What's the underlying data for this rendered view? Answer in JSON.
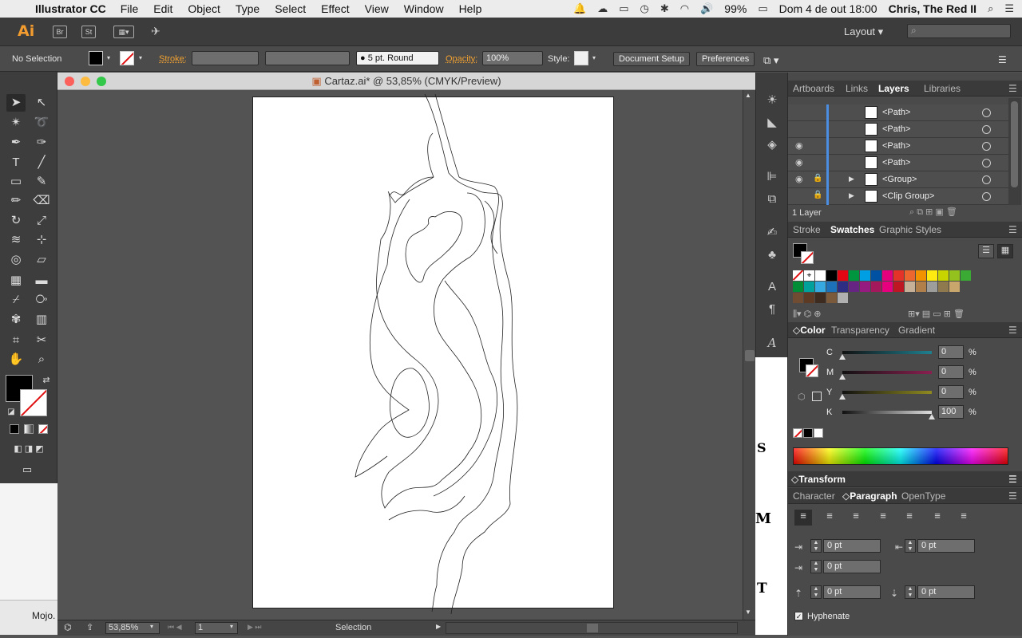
{
  "menubar": {
    "app_name": "Illustrator CC",
    "menus": [
      "File",
      "Edit",
      "Object",
      "Type",
      "Select",
      "Effect",
      "View",
      "Window",
      "Help"
    ],
    "battery": "99%",
    "datetime": "Dom 4 de out  18:00",
    "user": "Chris, The Red II"
  },
  "appbar": {
    "logo": "Ai",
    "bridge": "Br",
    "stock": "St",
    "workspace": "Layout",
    "workspace_caret": "▾"
  },
  "controlbar": {
    "selection": "No Selection",
    "stroke_label": "Stroke:",
    "brush": "5 pt. Round",
    "opacity_label": "Opacity:",
    "opacity_value": "100%",
    "style_label": "Style:",
    "document_setup": "Document Setup",
    "preferences": "Preferences"
  },
  "document": {
    "title": "Cartaz.ai* @ 53,85% (CMYK/Preview)",
    "zoom": "53,85%",
    "page": "1",
    "status_tool": "Selection"
  },
  "taskbar": {
    "item": "Mojo."
  },
  "layers_panel": {
    "tabs": [
      "Artboards",
      "Links",
      "Layers",
      "Libraries"
    ],
    "active_tab": "Layers",
    "rows": [
      {
        "name": "<Path>",
        "visible": false,
        "locked": false,
        "expandable": false
      },
      {
        "name": "<Path>",
        "visible": false,
        "locked": false,
        "expandable": false
      },
      {
        "name": "<Path>",
        "visible": true,
        "locked": false,
        "expandable": false
      },
      {
        "name": "<Path>",
        "visible": true,
        "locked": false,
        "expandable": false
      },
      {
        "name": "<Group>",
        "visible": true,
        "locked": true,
        "expandable": true
      },
      {
        "name": "<Clip Group>",
        "visible": false,
        "locked": true,
        "expandable": true
      }
    ],
    "footer": "1 Layer"
  },
  "swatches_panel": {
    "tabs": [
      "Stroke",
      "Swatches",
      "Graphic Styles"
    ],
    "active_tab": "Swatches",
    "row1": [
      "#ffffff",
      "#000000",
      "#e30613",
      "#009640",
      "#009fe3",
      "#0051a2",
      "#e5007d",
      "#e5332a",
      "#ec6730",
      "#f39200",
      "#fcea10",
      "#c8d400",
      "#95c11f",
      "#3aaa35"
    ],
    "row2": [
      "#008d36",
      "#00a19a",
      "#36a9e1",
      "#1d71b8",
      "#2d2e83",
      "#662483",
      "#951b81",
      "#a3195b",
      "#e6007e",
      "#be1622",
      "#c6b198",
      "#b17f4a",
      "#9d9d9c",
      "#8f7a50",
      "#c9a66b"
    ],
    "row3": [
      "#6f4c32",
      "#5c3a23",
      "#3d2b1f",
      "#7a5a3a",
      "#b0b0b0"
    ]
  },
  "color_panel": {
    "tabs": [
      "Color",
      "Transparency",
      "Gradient"
    ],
    "active_tab": "Color",
    "channels": [
      {
        "label": "C",
        "value": "0",
        "unit": "%",
        "track": "#1f7f8f",
        "fraction": 0.0
      },
      {
        "label": "M",
        "value": "0",
        "unit": "%",
        "track": "#8a2050",
        "fraction": 0.0
      },
      {
        "label": "Y",
        "value": "0",
        "unit": "%",
        "track": "#8f8a20",
        "fraction": 0.0
      },
      {
        "label": "K",
        "value": "100",
        "unit": "%",
        "track": "#dddddd",
        "fraction": 1.0
      }
    ]
  },
  "transform_panel": {
    "title": "Transform"
  },
  "paragraph_panel": {
    "tabs": [
      "Character",
      "Paragraph",
      "OpenType"
    ],
    "active_tab": "Paragraph",
    "left_indent": "0 pt",
    "right_indent": "0 pt",
    "first_line_indent": "0 pt",
    "space_before": "0 pt",
    "space_after": "0 pt",
    "hyphenate_label": "Hyphenate",
    "hyphenate_checked": true
  }
}
